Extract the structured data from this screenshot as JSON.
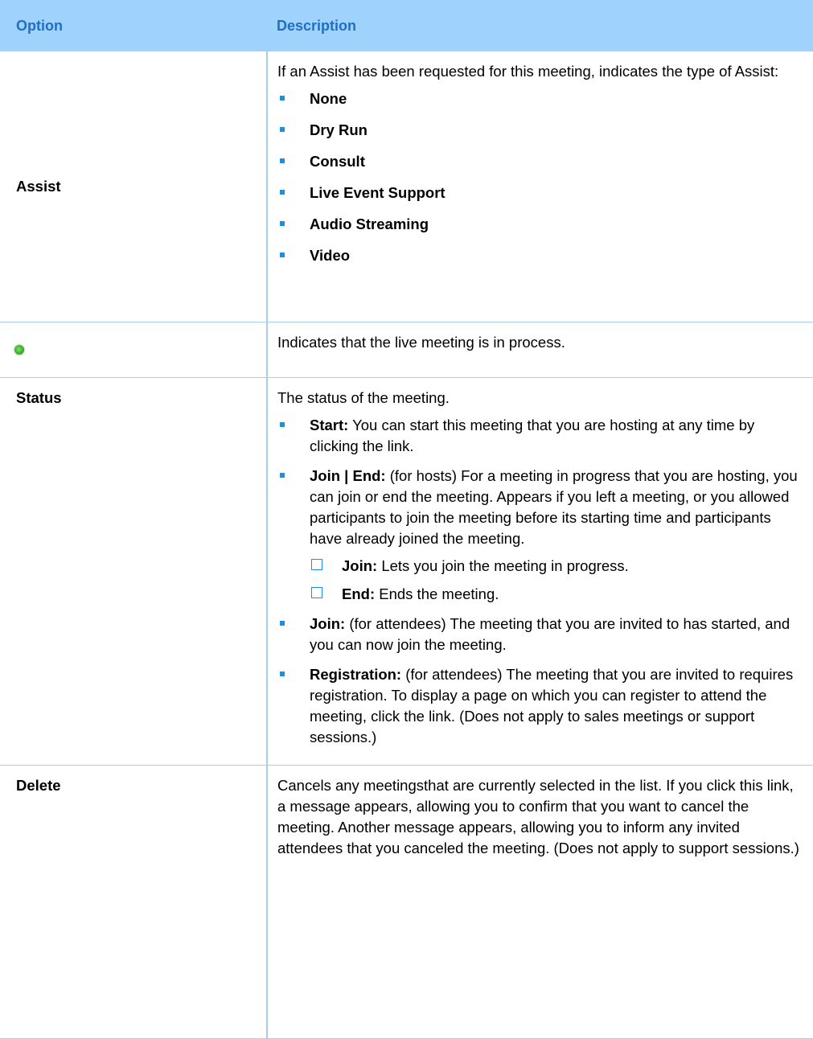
{
  "header": {
    "option": "Option",
    "description": "Description"
  },
  "assist": {
    "option": "Assist",
    "intro": "If an Assist has been requested for this meeting, indicates the type of Assist:",
    "items": [
      "None",
      "Dry Run",
      "Consult",
      "Live Event Support",
      "Audio Streaming",
      "Video"
    ]
  },
  "live": {
    "icon": "green-dot-icon",
    "description": "Indicates that the live meeting is in process."
  },
  "status": {
    "option": "Status",
    "intro": "The status of the meeting.",
    "items": [
      {
        "label": "Start:",
        "text": " You can start this meeting that you are hosting at any time by clicking the link."
      },
      {
        "label": "Join | End:",
        "text": " (for hosts) For a meeting in progress that you are hosting, you can join or end the meeting. Appears if you left a meeting, or you allowed participants to join the meeting before its starting time and participants have already joined the meeting."
      },
      {
        "label": "Join:",
        "text": " (for attendees) The meeting that you are invited to has started, and you can now join the meeting."
      },
      {
        "label": "Registration:",
        "text": " (for attendees) The meeting that you are invited to requires registration. To display a page on which you can register to attend the meeting, click the link. (Does not apply to sales meetings or support sessions.)"
      }
    ],
    "subitems": [
      {
        "label": "Join:",
        "text": " Lets you join the meeting in progress."
      },
      {
        "label": "End:",
        "text": " Ends the meeting."
      }
    ]
  },
  "delete": {
    "option": "Delete",
    "description": "Cancels any meetingsthat are currently selected in the list. If you click this link, a message appears, allowing you to confirm that you want to cancel the meeting. Another message appears, allowing you to inform any invited attendees that you canceled the meeting. (Does not apply to support sessions.)"
  },
  "colors": {
    "header_bg": "#9fd2fc",
    "header_text": "#1f6fc6",
    "bullet": "#1d8fe3",
    "rule": "#a8cde8"
  }
}
